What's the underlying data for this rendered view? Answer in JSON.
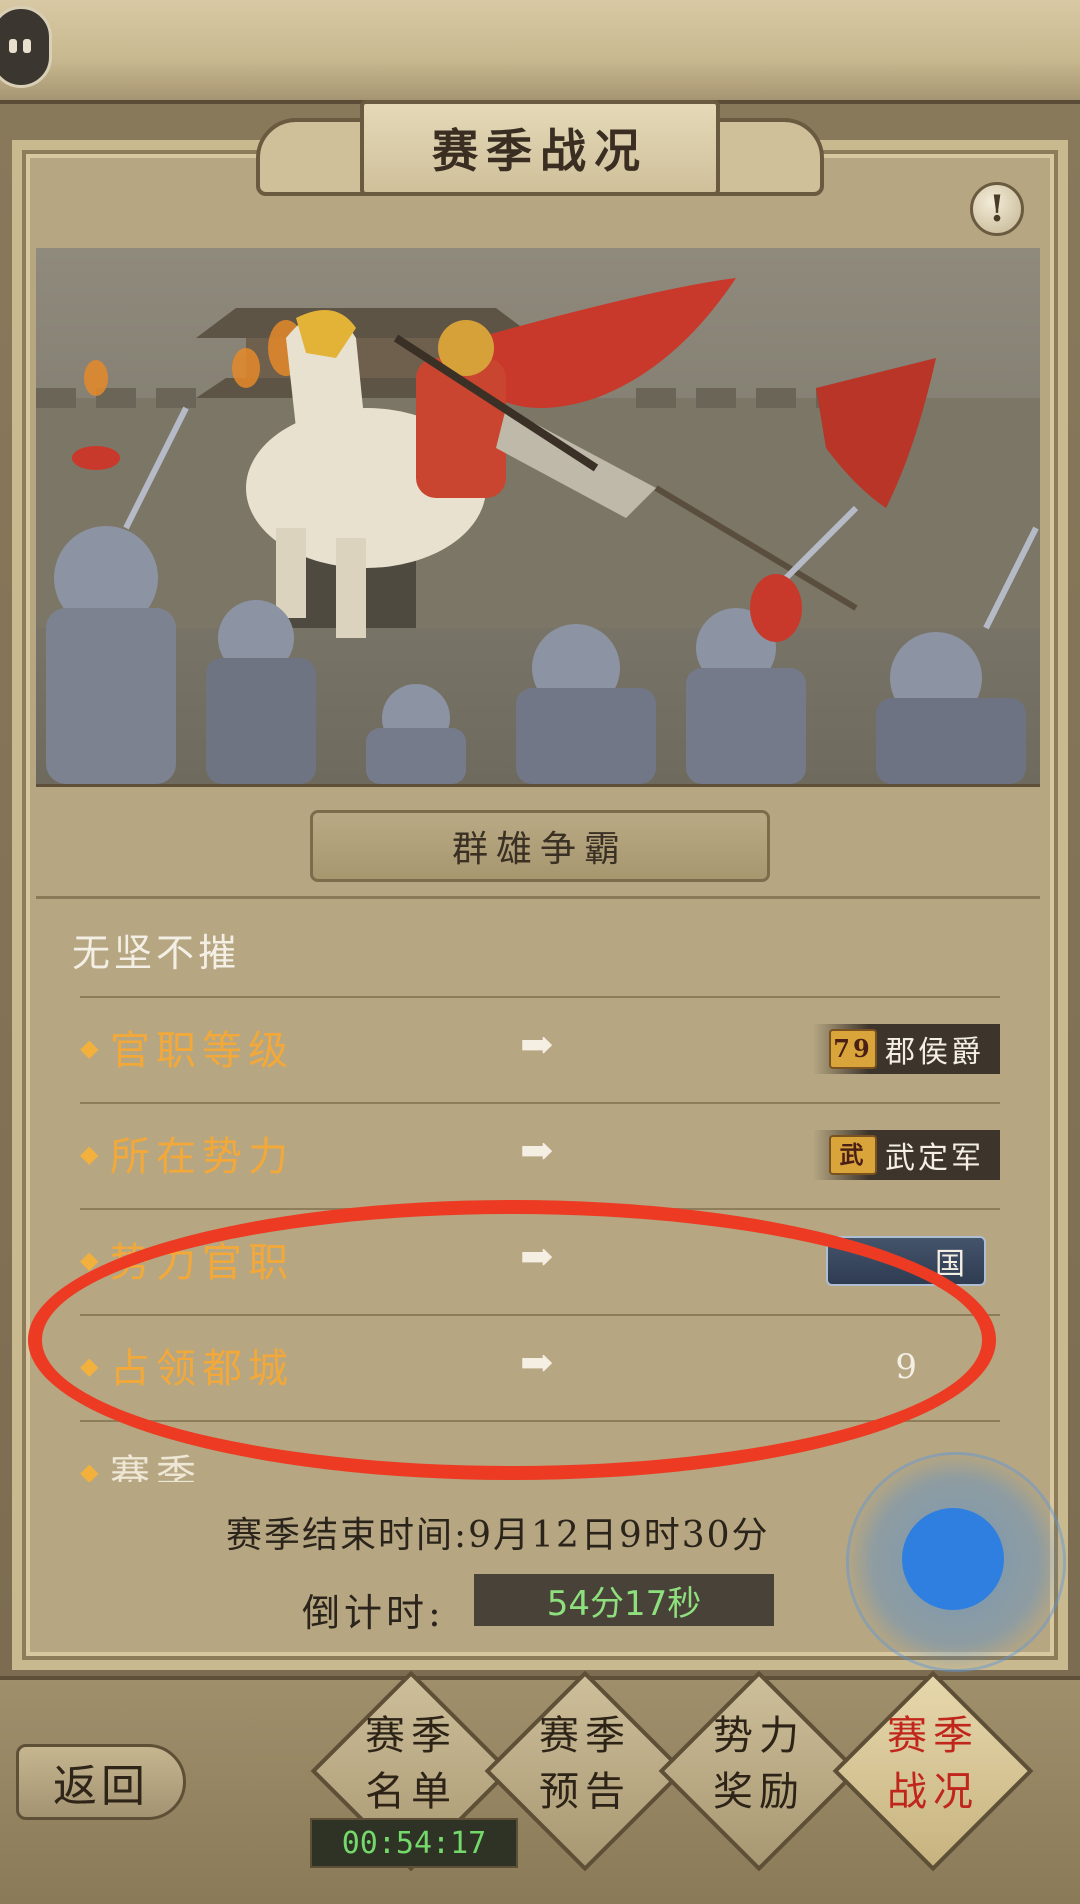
{
  "header": {
    "title": "赛季战况"
  },
  "banner": {
    "title": "群雄争霸"
  },
  "player": {
    "name": "无坚不摧"
  },
  "rows": [
    {
      "label": "官职等级",
      "value": "郡侯爵",
      "badge": "79"
    },
    {
      "label": "所在势力",
      "value": "武定军",
      "badge": "武"
    },
    {
      "label": "势力官职",
      "value": "国"
    },
    {
      "label": "占领都城",
      "value": "9"
    },
    {
      "label": "赛季"
    }
  ],
  "season": {
    "end_time": "赛季结束时间:9月12日9时30分",
    "countdown_label": "倒计时:",
    "countdown_value": "54分17秒"
  },
  "bottom_nav": {
    "back_label": "返回",
    "tabs": [
      {
        "label": "赛季名单",
        "line1": "赛季",
        "line2": "名单"
      },
      {
        "label": "赛季预告",
        "line1": "赛季",
        "line2": "预告"
      },
      {
        "label": "势力奖励",
        "line1": "势力",
        "line2": "奖励"
      },
      {
        "label": "赛季战况",
        "line1": "赛季",
        "line2": "战况",
        "active": true
      }
    ],
    "timer": "00:54:17"
  },
  "colors": {
    "label_gold": "#f2a93a",
    "highlight_red": "#ec3b22",
    "countdown_green": "#8ee07e",
    "touch_blue": "#2e7fe0"
  },
  "icons": {
    "menu": "menu-bubble-icon",
    "info": "exclamation-icon",
    "arrow": "right-arrow-icon",
    "diamond": "diamond-bullet-icon"
  }
}
